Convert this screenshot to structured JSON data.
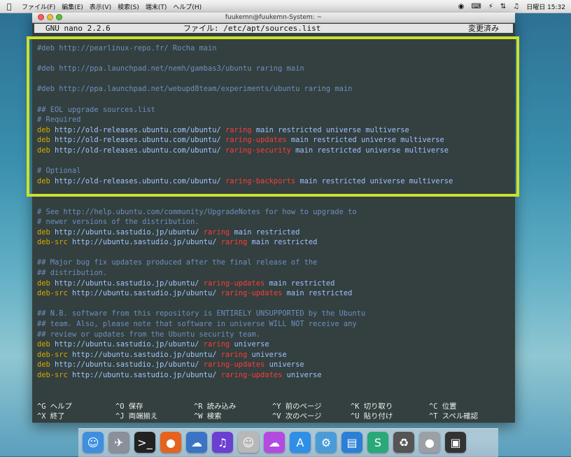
{
  "menubar": {
    "items": [
      "ファイル(F)",
      "編集(E)",
      "表示(V)",
      "検索(S)",
      "端末(T)",
      "ヘルプ(H)"
    ],
    "clock": "日曜日 15:32"
  },
  "window": {
    "title": "fuukemn@fuukemn-System: ~"
  },
  "nano": {
    "version": "GNU nano 2.2.6",
    "file": "ファイル: /etc/apt/sources.list",
    "status": "変更済み"
  },
  "lines": [
    [
      {
        "t": "#deb http://pearlinux-repo.fr/ Rocha main",
        "c": "comment"
      }
    ],
    [],
    [
      {
        "t": "#deb http://ppa.launchpad.net/nemh/gambas3/ubuntu raring main",
        "c": "comment"
      }
    ],
    [],
    [
      {
        "t": "#deb http://ppa.launchpad.net/webupd8team/experiments/ubuntu raring main",
        "c": "comment"
      }
    ],
    [],
    [
      {
        "t": "## EOL upgrade sources.list",
        "c": "comment"
      }
    ],
    [
      {
        "t": "# Required",
        "c": "comment"
      }
    ],
    [
      {
        "t": "deb ",
        "c": "key"
      },
      {
        "t": "http://old-releases.ubuntu.com/ubuntu/ ",
        "c": "url"
      },
      {
        "t": "raring",
        "c": "red"
      },
      {
        "t": " main restricted universe multiverse",
        "c": "plain"
      }
    ],
    [
      {
        "t": "deb ",
        "c": "key"
      },
      {
        "t": "http://old-releases.ubuntu.com/ubuntu/ ",
        "c": "url"
      },
      {
        "t": "raring-updates",
        "c": "red"
      },
      {
        "t": " main restricted universe multiverse",
        "c": "plain"
      }
    ],
    [
      {
        "t": "deb ",
        "c": "key"
      },
      {
        "t": "http://old-releases.ubuntu.com/ubuntu/ ",
        "c": "url"
      },
      {
        "t": "raring-security",
        "c": "red"
      },
      {
        "t": " main restricted universe multiverse",
        "c": "plain"
      }
    ],
    [],
    [
      {
        "t": "# Optional",
        "c": "comment"
      }
    ],
    [
      {
        "t": "deb ",
        "c": "key"
      },
      {
        "t": "http://old-releases.ubuntu.com/ubuntu/ ",
        "c": "url"
      },
      {
        "t": "raring-backports",
        "c": "red"
      },
      {
        "t": " main restricted universe multiverse",
        "c": "plain"
      }
    ],
    [],
    [],
    [
      {
        "t": "# See http://help.ubuntu.com/community/UpgradeNotes for how to upgrade to",
        "c": "comment"
      }
    ],
    [
      {
        "t": "# newer versions of the distribution.",
        "c": "comment"
      }
    ],
    [
      {
        "t": "deb ",
        "c": "key"
      },
      {
        "t": "http://ubuntu.sastudio.jp/ubuntu/ ",
        "c": "url"
      },
      {
        "t": "raring",
        "c": "red"
      },
      {
        "t": " main restricted",
        "c": "plain"
      }
    ],
    [
      {
        "t": "deb-src ",
        "c": "key"
      },
      {
        "t": "http://ubuntu.sastudio.jp/ubuntu/ ",
        "c": "url"
      },
      {
        "t": "raring",
        "c": "red"
      },
      {
        "t": " main restricted",
        "c": "plain"
      }
    ],
    [],
    [
      {
        "t": "## Major bug fix updates produced after the final release of the",
        "c": "comment"
      }
    ],
    [
      {
        "t": "## distribution.",
        "c": "comment"
      }
    ],
    [
      {
        "t": "deb ",
        "c": "key"
      },
      {
        "t": "http://ubuntu.sastudio.jp/ubuntu/ ",
        "c": "url"
      },
      {
        "t": "raring-updates",
        "c": "red"
      },
      {
        "t": " main restricted",
        "c": "plain"
      }
    ],
    [
      {
        "t": "deb-src ",
        "c": "key"
      },
      {
        "t": "http://ubuntu.sastudio.jp/ubuntu/ ",
        "c": "url"
      },
      {
        "t": "raring-updates",
        "c": "red"
      },
      {
        "t": " main restricted",
        "c": "plain"
      }
    ],
    [],
    [
      {
        "t": "## N.B. software from this repository is ENTIRELY UNSUPPORTED by the Ubuntu",
        "c": "comment"
      }
    ],
    [
      {
        "t": "## team. Also, please note that software in universe WILL NOT receive any",
        "c": "comment"
      }
    ],
    [
      {
        "t": "## review or updates from the Ubuntu security team.",
        "c": "comment"
      }
    ],
    [
      {
        "t": "deb ",
        "c": "key"
      },
      {
        "t": "http://ubuntu.sastudio.jp/ubuntu/ ",
        "c": "url"
      },
      {
        "t": "raring",
        "c": "red"
      },
      {
        "t": " universe",
        "c": "plain"
      }
    ],
    [
      {
        "t": "deb-src ",
        "c": "key"
      },
      {
        "t": "http://ubuntu.sastudio.jp/ubuntu/ ",
        "c": "url"
      },
      {
        "t": "raring",
        "c": "red"
      },
      {
        "t": " universe",
        "c": "plain"
      }
    ],
    [
      {
        "t": "deb ",
        "c": "key"
      },
      {
        "t": "http://ubuntu.sastudio.jp/ubuntu/ ",
        "c": "url"
      },
      {
        "t": "raring-updates",
        "c": "red"
      },
      {
        "t": " universe",
        "c": "plain"
      }
    ],
    [
      {
        "t": "deb-src ",
        "c": "key"
      },
      {
        "t": "http://ubuntu.sastudio.jp/ubuntu/ ",
        "c": "url"
      },
      {
        "t": "raring-updates",
        "c": "red"
      },
      {
        "t": " universe",
        "c": "plain"
      }
    ]
  ],
  "shortcuts": [
    [
      {
        "key": "^G",
        "label": "ヘルプ",
        "name": "help"
      },
      {
        "key": "^O",
        "label": "保存",
        "name": "save"
      },
      {
        "key": "^R",
        "label": "読み込み",
        "name": "read-file"
      },
      {
        "key": "^Y",
        "label": "前のページ",
        "name": "prev-page"
      },
      {
        "key": "^K",
        "label": "切り取り",
        "name": "cut"
      },
      {
        "key": "^C",
        "label": "位置",
        "name": "cur-pos"
      }
    ],
    [
      {
        "key": "^X",
        "label": "終了",
        "name": "exit"
      },
      {
        "key": "^J",
        "label": "両端揃え",
        "name": "justify"
      },
      {
        "key": "^W",
        "label": "検索",
        "name": "where-is"
      },
      {
        "key": "^V",
        "label": "次のページ",
        "name": "next-page"
      },
      {
        "key": "^U",
        "label": "貼り付け",
        "name": "uncut"
      },
      {
        "key": "^T",
        "label": "スペル確認",
        "name": "spell"
      }
    ]
  ],
  "dock": [
    "finder-icon",
    "launchpad-icon",
    "terminal-icon",
    "firefox-icon",
    "thunderbird-icon",
    "itunes-icon",
    "contacts-icon",
    "icloud-icon",
    "app-store-icon",
    "settings-icon",
    "network-icon",
    "preview-icon",
    "trash-icon",
    "camera-icon",
    "film-icon"
  ],
  "colors": {
    "terminal_bg": "#33403f",
    "comment": "#6e8fbf",
    "keyword": "#d8a800",
    "url": "#a4c6ff",
    "release": "#ff3a3a",
    "highlight_frame": "#cce12a"
  }
}
